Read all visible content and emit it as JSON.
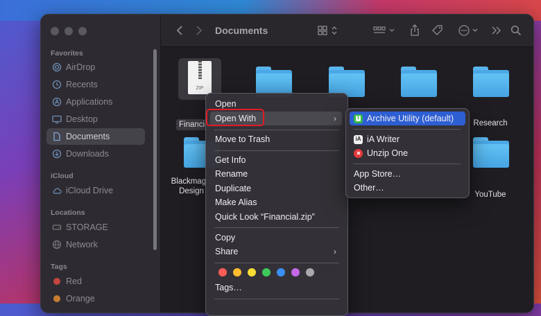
{
  "window": {
    "title": "Documents",
    "toolbar_icons": [
      "back-icon",
      "forward-icon",
      "icon-view-icon",
      "group-icon",
      "share-icon",
      "tag-icon",
      "more-icon",
      "overflow-icon",
      "search-icon"
    ]
  },
  "sidebar": {
    "favorites_header": "Favorites",
    "favorites": [
      {
        "label": "AirDrop",
        "icon": "airdrop-icon"
      },
      {
        "label": "Recents",
        "icon": "clock-icon"
      },
      {
        "label": "Applications",
        "icon": "applications-icon"
      },
      {
        "label": "Desktop",
        "icon": "desktop-icon"
      },
      {
        "label": "Documents",
        "icon": "document-icon",
        "active": true
      },
      {
        "label": "Downloads",
        "icon": "download-icon"
      }
    ],
    "icloud_header": "iCloud",
    "icloud": [
      {
        "label": "iCloud Drive",
        "icon": "cloud-icon"
      }
    ],
    "locations_header": "Locations",
    "locations": [
      {
        "label": "STORAGE",
        "icon": "drive-icon"
      },
      {
        "label": "Network",
        "icon": "globe-icon"
      }
    ],
    "tags_header": "Tags",
    "tags": [
      {
        "label": "Red",
        "color": "#e0443e"
      },
      {
        "label": "Orange",
        "color": "#f0902b"
      }
    ]
  },
  "files": {
    "zip": {
      "label": "Financial.zip",
      "icon_text": "ZIP"
    },
    "folders": [
      {
        "label": ""
      },
      {
        "label": ""
      },
      {
        "label": ""
      },
      {
        "label": "Research"
      },
      {
        "label": "Blackmagic Design"
      },
      {
        "label": "YouTube"
      }
    ]
  },
  "context_menu": {
    "open": "Open",
    "open_with": "Open With",
    "move_to_trash": "Move to Trash",
    "get_info": "Get Info",
    "rename": "Rename",
    "duplicate": "Duplicate",
    "make_alias": "Make Alias",
    "quick_look": "Quick Look “Financial.zip”",
    "copy": "Copy",
    "share": "Share",
    "tags": "Tags…",
    "tag_colors": [
      "#ff5e57",
      "#febc2e",
      "#f7dc35",
      "#3ec95a",
      "#3b8ff5",
      "#c469e8",
      "#a9a8ad"
    ]
  },
  "open_with_menu": {
    "default_app": "Archive Utility (default)",
    "apps": [
      "iA Writer",
      "Unzip One"
    ],
    "app_store": "App Store…",
    "other": "Other…"
  }
}
